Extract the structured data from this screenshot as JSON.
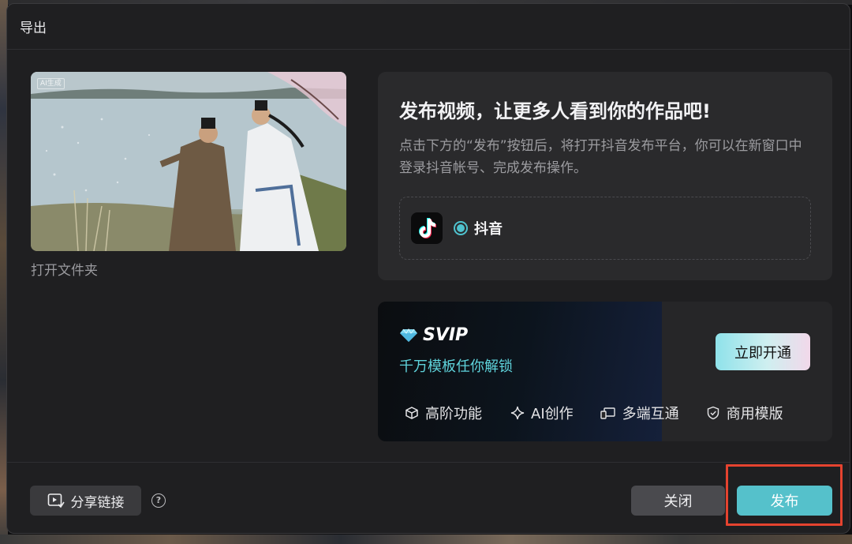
{
  "dialog": {
    "title": "导出"
  },
  "preview": {
    "ai_badge": "AI生成",
    "open_folder_label": "打开文件夹"
  },
  "publish": {
    "heading": "发布视频，让更多人看到你的作品吧!",
    "description": "点击下方的“发布”按钮后，将打开抖音发布平台，你可以在新窗口中登录抖音帐号、完成发布操作。",
    "platform": {
      "name": "抖音",
      "icon": "tiktok-logo-icon",
      "selected": true
    }
  },
  "svip": {
    "title": "SVIP",
    "subtitle": "千万模板任你解锁",
    "cta_label": "立即开通",
    "features": [
      {
        "icon": "cube-icon",
        "label": "高阶功能"
      },
      {
        "icon": "sparkle-icon",
        "label": "AI创作"
      },
      {
        "icon": "devices-icon",
        "label": "多端互通"
      },
      {
        "icon": "shield-check-icon",
        "label": "商用模版"
      }
    ],
    "accent_color": "#5fd3db"
  },
  "footer": {
    "share_label": "分享链接",
    "help_icon": "?",
    "close_label": "关闭",
    "publish_label": "发布"
  },
  "colors": {
    "primary": "#55c1cb",
    "highlight": "#e5432f",
    "dialog_bg": "#1f1f21"
  }
}
